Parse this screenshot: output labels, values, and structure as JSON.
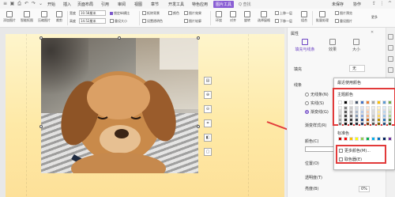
{
  "menu": {
    "items": [
      "开始",
      "插入",
      "页面布局",
      "引用",
      "审阅",
      "视图",
      "章节",
      "开发工具",
      "特色应用",
      "图片工具"
    ],
    "active_index": 9,
    "search": "Q 查找",
    "right": "未保存",
    "collab": "协作"
  },
  "ribbon": {
    "tools": [
      {
        "label": "添加图片",
        "icon": "add-picture-icon"
      },
      {
        "label": "智能抠图",
        "icon": "smart-cutout-icon"
      },
      {
        "label": "压缩图片",
        "icon": "compress-icon"
      },
      {
        "label": "裁剪",
        "icon": "crop-icon"
      }
    ],
    "width_label": "宽度",
    "width_value": "10.58厘米",
    "height_label": "高度",
    "height_value": "14.52厘米",
    "lock_ratio": "锁定纵横比",
    "reset_size": "重设大小",
    "clear_bg": "抠除背景",
    "set_transparent": "设置透明色",
    "color": "颜色",
    "effects": "图片效果",
    "outline": "图片轮廓",
    "wrap": "环绕",
    "align": "对齐",
    "rotate": "旋转",
    "select_pane": "选择窗格",
    "bring_forward": "上移一层",
    "send_backward": "下移一层",
    "combine": "组合",
    "batch": "批量处理",
    "preview": "图片预览",
    "reset": "重设图片",
    "more": "更多"
  },
  "image_toolbar": [
    "layout-icon",
    "zoom-in-icon",
    "zoom-out-icon",
    "crop-icon",
    "fill-icon",
    "outline-icon"
  ],
  "panel": {
    "title": "属性",
    "tabs": [
      {
        "label": "填充与线条",
        "icon": "fill-line-icon"
      },
      {
        "label": "效果",
        "icon": "effects-icon"
      },
      {
        "label": "大小",
        "icon": "size-icon"
      }
    ],
    "fill_label": "填充",
    "fill_value": "无",
    "line_label": "线条",
    "line_options": [
      "无线条(N)",
      "实线(S)",
      "渐变线(G)"
    ],
    "line_selected": 2,
    "gradient_label": "渐变样式(R)",
    "color_label": "颜色(C)",
    "position_label": "位置(O)",
    "transparency_label": "透明度(T)",
    "brightness_label": "亮度(B)",
    "percent": "0%"
  },
  "color_popup": {
    "recent_label": "最近使用颜色",
    "theme_label": "主题颜色",
    "standard_label": "标准色",
    "more_colors": "更多颜色(M)...",
    "eyedropper": "取色器(E)",
    "theme_columns": [
      [
        "#ffffff",
        "#f2f2f2",
        "#d9d9d9",
        "#bfbfbf",
        "#a6a6a6",
        "#808080"
      ],
      [
        "#000000",
        "#7f7f7f",
        "#595959",
        "#404040",
        "#262626",
        "#0d0d0d"
      ],
      [
        "#e7e6e6",
        "#d0cece",
        "#aeabab",
        "#757070",
        "#3b3838",
        "#171616"
      ],
      [
        "#44546a",
        "#d6dce4",
        "#adb9ca",
        "#8497b0",
        "#333f4f",
        "#222a35"
      ],
      [
        "#4472c4",
        "#dae3f3",
        "#b4c7e7",
        "#8faadc",
        "#2f5597",
        "#203864"
      ],
      [
        "#ed7d31",
        "#fbe5d6",
        "#f8cbad",
        "#f4b183",
        "#c55a11",
        "#843c0c"
      ],
      [
        "#a5a5a5",
        "#ededed",
        "#dbdbdb",
        "#c9c9c9",
        "#7b7b7b",
        "#525252"
      ],
      [
        "#ffc000",
        "#fff2cc",
        "#ffe699",
        "#ffd966",
        "#bf9000",
        "#7f6000"
      ],
      [
        "#5b9bd5",
        "#deebf7",
        "#bdd7ee",
        "#9dc3e6",
        "#2e75b6",
        "#1f4e79"
      ],
      [
        "#70ad47",
        "#e2f0d9",
        "#c5e0b4",
        "#a9d18e",
        "#548235",
        "#385723"
      ]
    ],
    "standard_colors": [
      "#c00000",
      "#ff0000",
      "#ffc000",
      "#ffff00",
      "#92d050",
      "#00b050",
      "#00b0f0",
      "#0070c0",
      "#002060",
      "#7030a0"
    ],
    "accent": "#e23a3a"
  },
  "colors": {
    "accent": "#7b57c9",
    "highlight": "#e23a3a"
  }
}
